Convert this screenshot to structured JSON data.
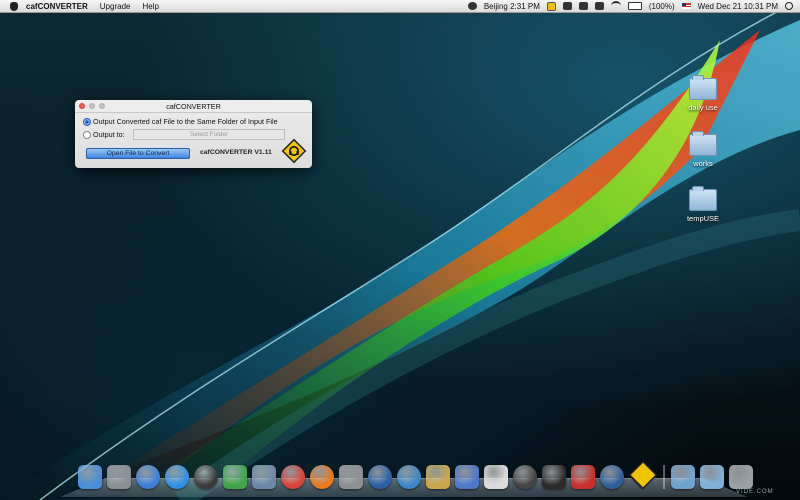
{
  "menubar": {
    "app_name": "cafCONVERTER",
    "menus": [
      "Upgrade",
      "Help"
    ],
    "clock_city": "Beijing 2:31 PM",
    "battery": "(100%)",
    "date_time": "Wed Dec 21  10:31 PM",
    "icons": [
      "apple-icon",
      "world-clock-icon",
      "warning-sign-icon",
      "volume-icon",
      "display-icon",
      "bluetooth-icon",
      "wifi-icon",
      "battery-icon",
      "us-flag-icon",
      "spotlight-icon"
    ]
  },
  "window": {
    "title": "cafCONVERTER",
    "option_same_folder": "Output Converted caf File to the Same Folder of Input File",
    "option_output_to": "Output to:",
    "folder_placeholder": "Select Folder",
    "open_button": "Open File to Convert",
    "version": "cafCONVERTER V1.11",
    "selected_option": "same_folder"
  },
  "desktop": {
    "folders": [
      {
        "name": "daily use"
      },
      {
        "name": "works"
      },
      {
        "name": "tempUSE"
      }
    ]
  },
  "dock": {
    "items": [
      {
        "name": "finder",
        "color": "#4a8fd8"
      },
      {
        "name": "launchpad",
        "color": "#8a8f96"
      },
      {
        "name": "itunes",
        "color": "#3b7fd9"
      },
      {
        "name": "app-store",
        "color": "#2f8fe6"
      },
      {
        "name": "dashboard",
        "color": "#3a3a3a"
      },
      {
        "name": "messenger",
        "color": "#3fa64a"
      },
      {
        "name": "preview",
        "color": "#6f88a8"
      },
      {
        "name": "chrome",
        "color": "#d9433a"
      },
      {
        "name": "firefox",
        "color": "#e8791f"
      },
      {
        "name": "system-preferences",
        "color": "#8d8f93"
      },
      {
        "name": "google-earth",
        "color": "#2c5fa6"
      },
      {
        "name": "safari",
        "color": "#3b86c9"
      },
      {
        "name": "xcode",
        "color": "#c9a64a"
      },
      {
        "name": "automator",
        "color": "#4d79c7"
      },
      {
        "name": "textedit",
        "color": "#dcdcdc"
      },
      {
        "name": "zipeg",
        "color": "#444444"
      },
      {
        "name": "terminal",
        "color": "#2b2b2b"
      },
      {
        "name": "photo-booth",
        "color": "#c9302c"
      },
      {
        "name": "quicktime",
        "color": "#2d5f9a"
      },
      {
        "name": "cafconverter",
        "color": "#f0c400"
      },
      {
        "name": "applications-stack",
        "color": "#6ea3cf"
      },
      {
        "name": "downloads-stack",
        "color": "#7fb0d8"
      },
      {
        "name": "trash",
        "color": "#9aa2a8"
      }
    ],
    "brand_text": "VIDE.COM"
  }
}
